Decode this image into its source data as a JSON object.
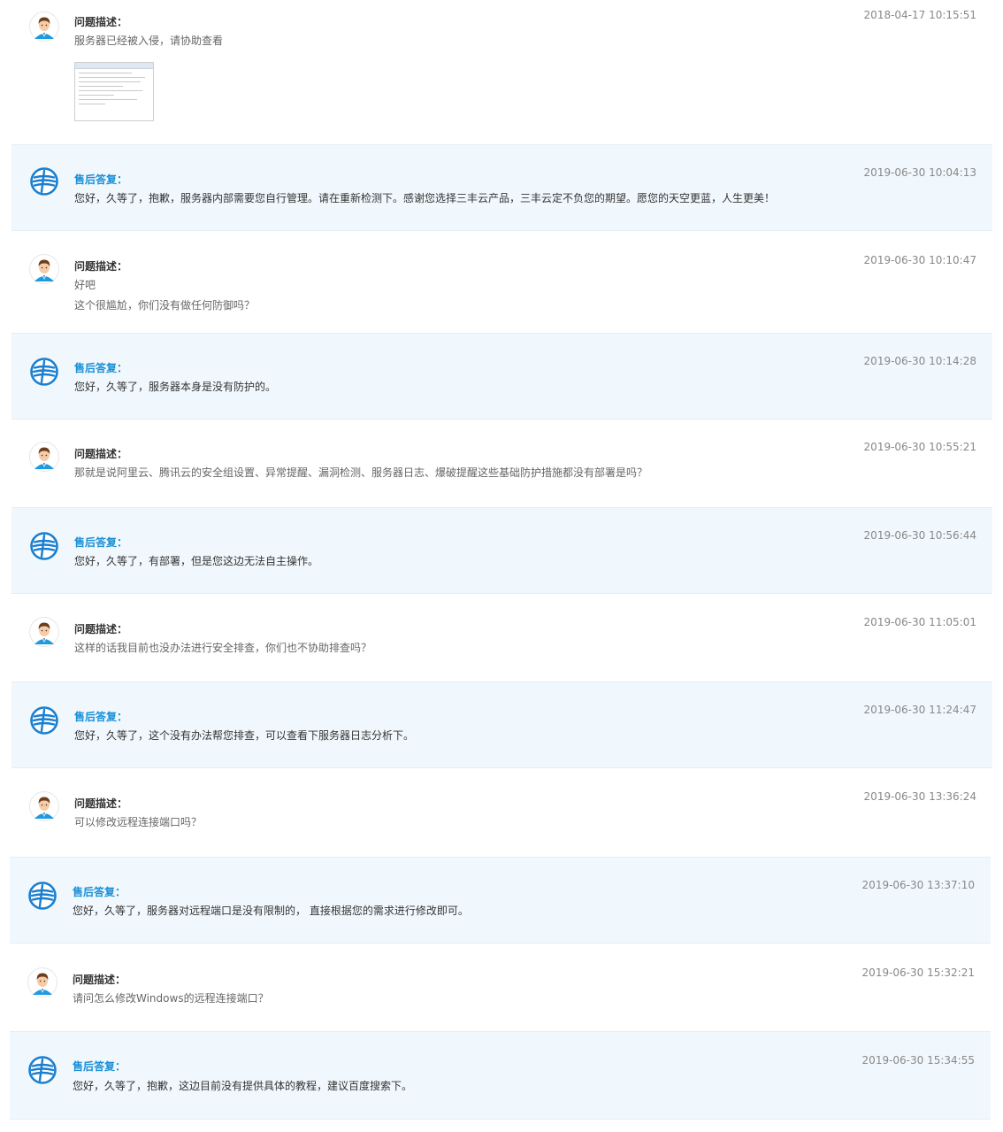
{
  "labels": {
    "question": "问题描述：",
    "reply": "售后答复："
  },
  "colors": {
    "reply_background": "#f1f8fd",
    "reply_title": "#1a8fd6",
    "question_title": "#333333",
    "timestamp": "#888888"
  },
  "icons": {
    "user_avatar": "user-avatar-icon",
    "support_logo": "support-logo-icon",
    "attachment": "screenshot-thumbnail"
  },
  "messages": [
    {
      "type": "question",
      "time": "2018-04-17 10:15:51",
      "lines": [
        "服务器已经被入侵，请协助查看"
      ],
      "attachment": true
    },
    {
      "type": "reply",
      "time": "2019-06-30 10:04:13",
      "lines": [
        "您好，久等了，抱歉，服务器内部需要您自行管理。请在重新检测下。感谢您选择三丰云产品，三丰云定不负您的期望。愿您的天空更蓝，人生更美！"
      ]
    },
    {
      "type": "question",
      "time": "2019-06-30 10:10:47",
      "lines": [
        "好吧",
        "这个很尴尬，你们没有做任何防御吗？"
      ]
    },
    {
      "type": "reply",
      "time": "2019-06-30 10:14:28",
      "lines": [
        "您好，久等了，服务器本身是没有防护的。"
      ]
    },
    {
      "type": "question",
      "time": "2019-06-30 10:55:21",
      "lines": [
        "那就是说阿里云、腾讯云的安全组设置、异常提醒、漏洞检测、服务器日志、爆破提醒这些基础防护措施都没有部署是吗？"
      ]
    },
    {
      "type": "reply",
      "time": "2019-06-30 10:56:44",
      "lines": [
        "您好，久等了，有部署，但是您这边无法自主操作。"
      ]
    },
    {
      "type": "question",
      "time": "2019-06-30 11:05:01",
      "lines": [
        "这样的话我目前也没办法进行安全排查，你们也不协助排查吗？"
      ]
    },
    {
      "type": "reply",
      "time": "2019-06-30 11:24:47",
      "lines": [
        "您好，久等了，这个没有办法帮您排查，可以查看下服务器日志分析下。"
      ]
    },
    {
      "type": "question",
      "time": "2019-06-30 13:36:24",
      "lines": [
        "可以修改远程连接端口吗？"
      ]
    },
    {
      "type": "reply",
      "time": "2019-06-30 13:37:10",
      "lines": [
        "您好，久等了，服务器对远程端口是没有限制的， 直接根据您的需求进行修改即可。"
      ]
    },
    {
      "type": "question",
      "time": "2019-06-30 15:32:21",
      "lines": [
        "请问怎么修改Windows的远程连接端口？"
      ]
    },
    {
      "type": "reply",
      "time": "2019-06-30 15:34:55",
      "lines": [
        "您好，久等了，抱歉，这边目前没有提供具体的教程，建议百度搜索下。"
      ]
    }
  ]
}
